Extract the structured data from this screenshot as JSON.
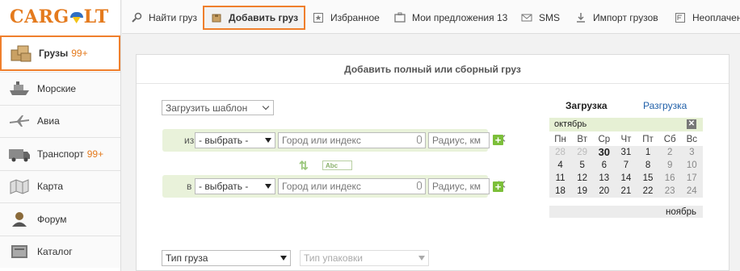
{
  "logo": {
    "text_left": "CARG",
    "text_right": "LT"
  },
  "sidebar": {
    "items": [
      {
        "label": "Грузы",
        "count": "99+",
        "icon": "boxes-icon"
      },
      {
        "label": "Морские",
        "count": "",
        "icon": "ship-icon"
      },
      {
        "label": "Авиа",
        "count": "",
        "icon": "airplane-icon"
      },
      {
        "label": "Транспорт",
        "count": "99+",
        "icon": "truck-icon"
      },
      {
        "label": "Карта",
        "count": "",
        "icon": "map-icon"
      },
      {
        "label": "Форум",
        "count": "",
        "icon": "forum-icon"
      },
      {
        "label": "Каталог",
        "count": "",
        "icon": "catalog-icon"
      }
    ]
  },
  "toolbar": {
    "items": [
      {
        "label": "Найти груз",
        "icon": "find-icon"
      },
      {
        "label": "Добавить груз",
        "icon": "add-cargo-icon"
      },
      {
        "label": "Избранное",
        "icon": "favorites-icon"
      },
      {
        "label": "Мои предложения 13",
        "icon": "offers-icon"
      },
      {
        "label": "SMS",
        "icon": "envelope-icon"
      },
      {
        "label": "Импорт грузов",
        "icon": "import-icon"
      },
      {
        "label": "Неоплачен",
        "icon": "unpaid-icon"
      }
    ]
  },
  "form": {
    "title": "Добавить полный или сборный груз",
    "template_select": "Загрузить шаблон",
    "from": {
      "prefix": "из",
      "country": "- выбрать -",
      "city_placeholder": "Город или индекс",
      "radius_placeholder": "Радиус, км"
    },
    "to": {
      "prefix": "в",
      "country": "- выбрать -",
      "city_placeholder": "Город или индекс",
      "radius_placeholder": "Радиус, км"
    },
    "abc_label": "Abc",
    "cargo_type": "Тип груза",
    "package_type": "Тип упаковки"
  },
  "calendar": {
    "tab_load": "Загрузка",
    "tab_unload": "Разгрузка",
    "month": "октябрь",
    "next_month": "ноябрь",
    "weekdays": [
      "Пн",
      "Вт",
      "Ср",
      "Чт",
      "Пт",
      "Сб",
      "Вс"
    ],
    "weeks": [
      [
        "28",
        "29",
        "30",
        "31",
        "1",
        "2",
        "3"
      ],
      [
        "4",
        "5",
        "6",
        "7",
        "8",
        "9",
        "10"
      ],
      [
        "11",
        "12",
        "13",
        "14",
        "15",
        "16",
        "17"
      ],
      [
        "18",
        "19",
        "20",
        "21",
        "22",
        "23",
        "24"
      ]
    ],
    "today": "30"
  },
  "colors": {
    "accent": "#ef7f2c",
    "logo": "#e47a1d",
    "green_row": "#e9f2da",
    "plus": "#7cbf3a",
    "link": "#1f5fa8"
  }
}
